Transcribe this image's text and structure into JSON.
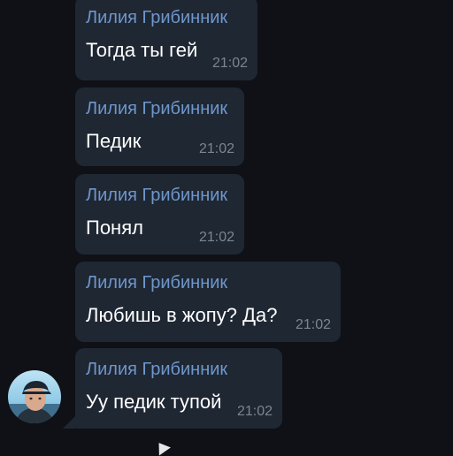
{
  "colors": {
    "background": "#0f1116",
    "bubble": "#1f2733",
    "sender_name": "#6e97cc",
    "message_text": "#ffffff",
    "timestamp": "#7d8591"
  },
  "messages": [
    {
      "sender": "Лилия Грибинник",
      "text": "Тогда ты гей",
      "time": "21:02"
    },
    {
      "sender": "Лилия Грибинник",
      "text": "Педик",
      "time": "21:02"
    },
    {
      "sender": "Лилия Грибинник",
      "text": "Понял",
      "time": "21:02"
    },
    {
      "sender": "Лилия Грибинник",
      "text": "Любишь в жопу? Да?",
      "time": "21:02"
    },
    {
      "sender": "Лилия Грибинник",
      "text": "Уу педик тупой",
      "time": "21:02"
    }
  ],
  "avatar": {
    "icon": "user-avatar-photo"
  }
}
